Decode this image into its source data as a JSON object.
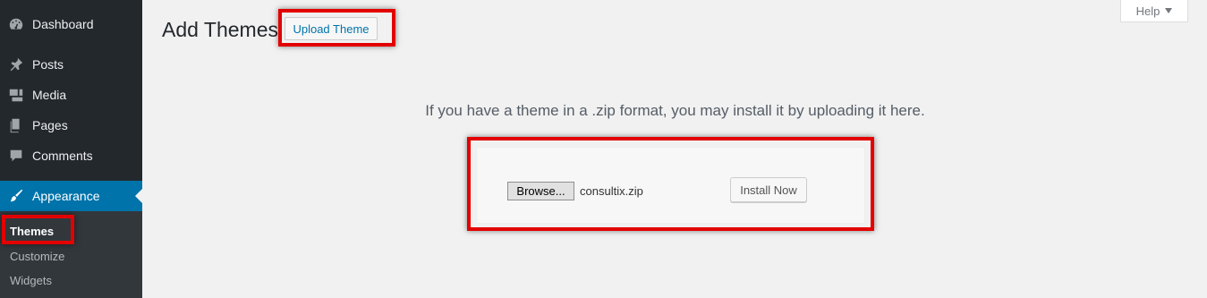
{
  "sidebar": {
    "items": [
      {
        "label": "Dashboard",
        "icon": "dashboard-icon"
      },
      {
        "label": "Posts",
        "icon": "pin-icon"
      },
      {
        "label": "Media",
        "icon": "media-icon"
      },
      {
        "label": "Pages",
        "icon": "pages-icon"
      },
      {
        "label": "Comments",
        "icon": "comment-icon"
      },
      {
        "label": "Appearance",
        "icon": "brush-icon"
      }
    ],
    "submenu": [
      "Themes",
      "Customize",
      "Widgets"
    ]
  },
  "header": {
    "title": "Add Themes",
    "upload_button": "Upload Theme",
    "help_label": "Help"
  },
  "upload": {
    "instructions": "If you have a theme in a .zip format, you may install it by uploading it here.",
    "browse_label": "Browse...",
    "file_name": "consultix.zip",
    "install_label": "Install Now"
  },
  "colors": {
    "sidebar_bg": "#23282d",
    "active_bg": "#0073aa",
    "highlight": "#e30000"
  }
}
